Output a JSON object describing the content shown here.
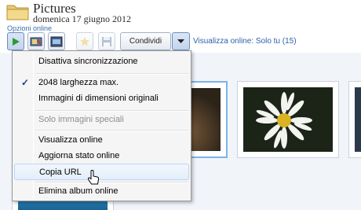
{
  "header": {
    "title": "Pictures",
    "date": "domenica 17 giugno 2012",
    "online_options": "Opzioni online"
  },
  "toolbar": {
    "share_label": "Condividi",
    "online_view": "Visualizza online: Solo tu (15)"
  },
  "menu": {
    "items": [
      {
        "label": "Disattiva sincronizzazione"
      },
      {
        "label": "2048 larghezza max.",
        "checked": true
      },
      {
        "label": "Immagini di dimensioni originali"
      },
      {
        "label": "Solo immagini speciali",
        "disabled": true
      },
      {
        "label": "Visualizza online"
      },
      {
        "label": "Aggiorna stato online"
      },
      {
        "label": "Copia URL",
        "highlighted": true
      },
      {
        "label": "Elimina album online"
      }
    ],
    "check_mark": "✓"
  },
  "colors": {
    "accent": "#2a62a8",
    "menu_highlight": "#b8d6fb",
    "gallery_bg": "#f1f5fa"
  }
}
